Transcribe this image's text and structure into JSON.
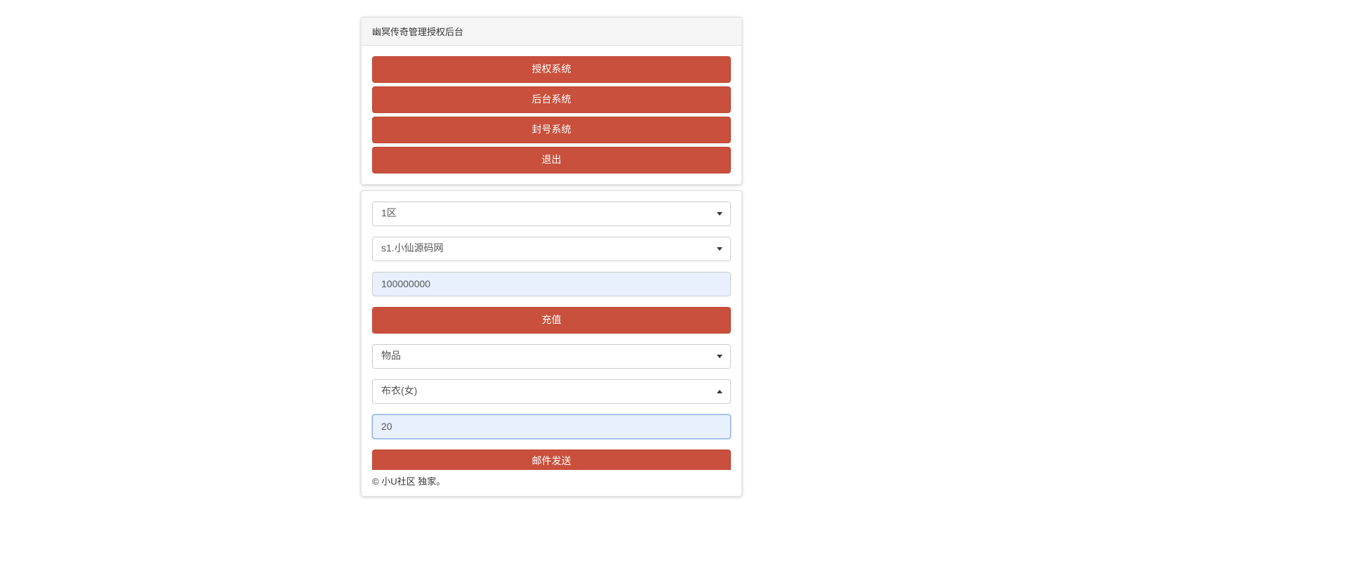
{
  "header": {
    "title": "幽冥传奇管理授权后台"
  },
  "nav_buttons": {
    "auth": "授权系统",
    "admin": "后台系统",
    "ban": "封号系统",
    "logout": "退出"
  },
  "form": {
    "zone_select": "1区",
    "server_select": "s1.小仙源码网",
    "amount_value": "100000000",
    "recharge_label": "充值",
    "type_select": "物品",
    "item_select": "布衣(女)",
    "quantity_value": "20",
    "mail_label": "邮件发送"
  },
  "footer": {
    "text": "© 小U社区 独家。"
  }
}
